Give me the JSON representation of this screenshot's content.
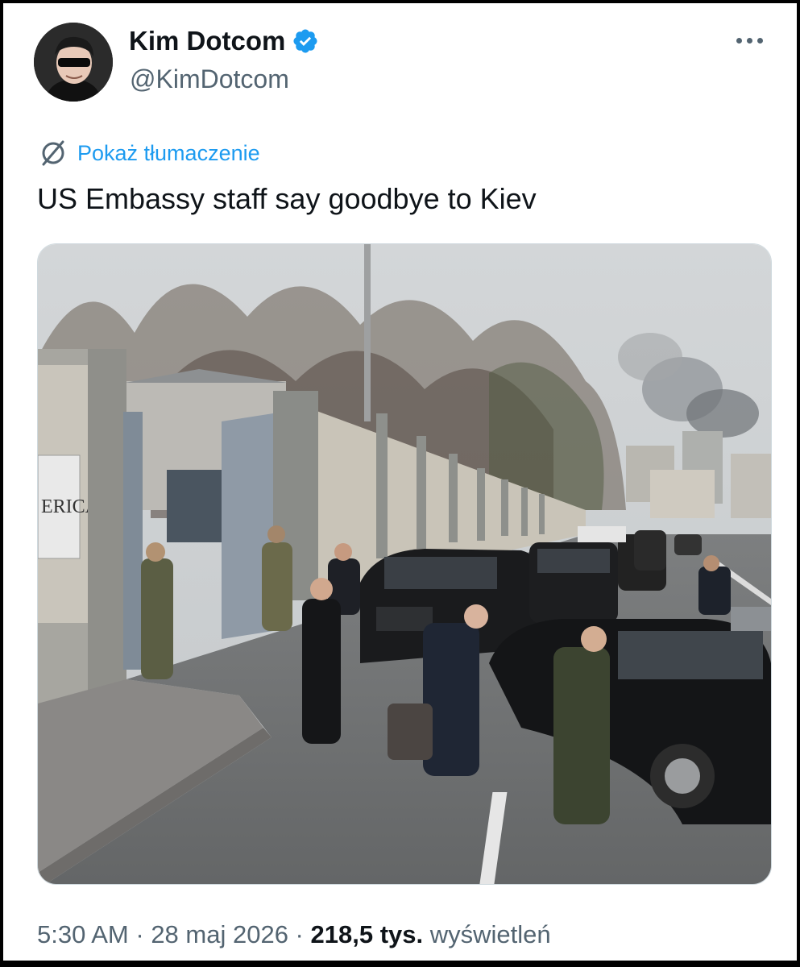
{
  "author": {
    "display_name": "Kim Dotcom",
    "handle": "@KimDotcom",
    "verified_icon": "verified-badge-icon",
    "avatar_icon": "avatar"
  },
  "menu": {
    "more_icon": "more-options-icon"
  },
  "translation": {
    "icon": "globe-translate-icon",
    "label": "Pokaż tłumaczenie"
  },
  "tweet": {
    "text": "US Embassy staff say goodbye to Kiev",
    "photo_sign_text": "ERICA"
  },
  "meta": {
    "time": "5:30 AM",
    "sep1": " · ",
    "date": "28 maj 2026",
    "sep2": " · ",
    "views_count": "218,5 tys.",
    "views_label": " wyświetleń"
  },
  "colors": {
    "accent": "#1d9bf0",
    "text": "#0f1419",
    "muted": "#536471"
  }
}
